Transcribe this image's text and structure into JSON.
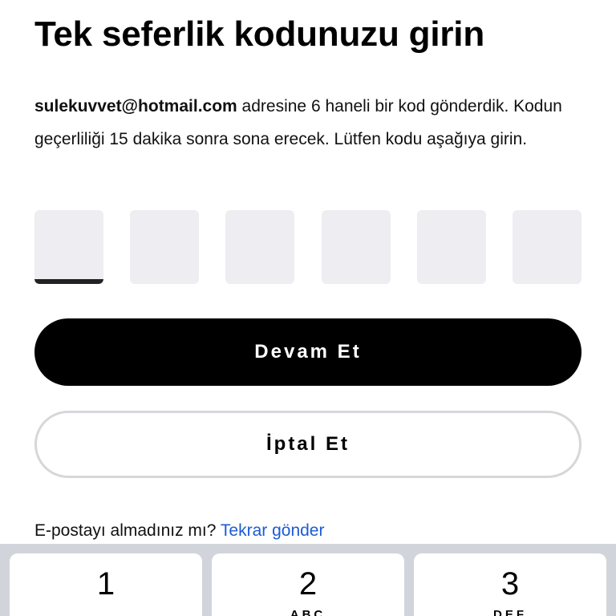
{
  "title": "Tek seferlik kodunuzu girin",
  "description": {
    "email": "sulekuvvet@hotmail.com",
    "text": " adresine 6 haneli bir kod gönderdik. Kodun geçerliliği 15 dakika sonra sona erecek. Lütfen kodu aşağıya girin."
  },
  "otp": {
    "digits": [
      "",
      "",
      "",
      "",
      "",
      ""
    ],
    "active_index": 0
  },
  "buttons": {
    "continue_label": "Devam Et",
    "cancel_label": "İptal Et"
  },
  "resend": {
    "prompt": "E-postayı almadınız mı?",
    "link": "Tekrar gönder"
  },
  "keyboard": {
    "keys": [
      {
        "number": "1",
        "letters": ""
      },
      {
        "number": "2",
        "letters": "ABC"
      },
      {
        "number": "3",
        "letters": "DEF"
      }
    ]
  },
  "colors": {
    "accent_link": "#1d5bd6",
    "primary_button": "#000000",
    "otp_box": "#eeeef2",
    "keyboard_background": "#d1d5db"
  }
}
